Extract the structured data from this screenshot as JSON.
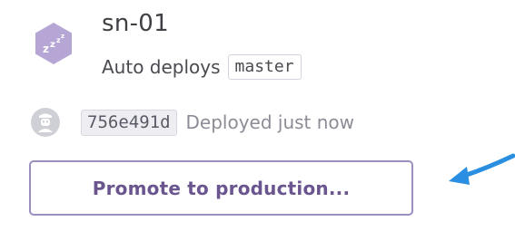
{
  "app": {
    "name": "sn-01",
    "icon": "sleeping-dyno-icon",
    "icon_color": "#b6a6d6"
  },
  "auto_deploy": {
    "label": "Auto deploys",
    "branch": "master"
  },
  "deployment": {
    "icon": "deployer-avatar-icon",
    "commit": "756e491d",
    "status": "Deployed just now"
  },
  "actions": {
    "promote_label": "Promote to production..."
  },
  "annotation": {
    "icon": "blue-arrow-icon",
    "color": "#2a8fe0"
  },
  "colors": {
    "button_border": "#9c8fc0",
    "button_text": "#6a558f"
  }
}
